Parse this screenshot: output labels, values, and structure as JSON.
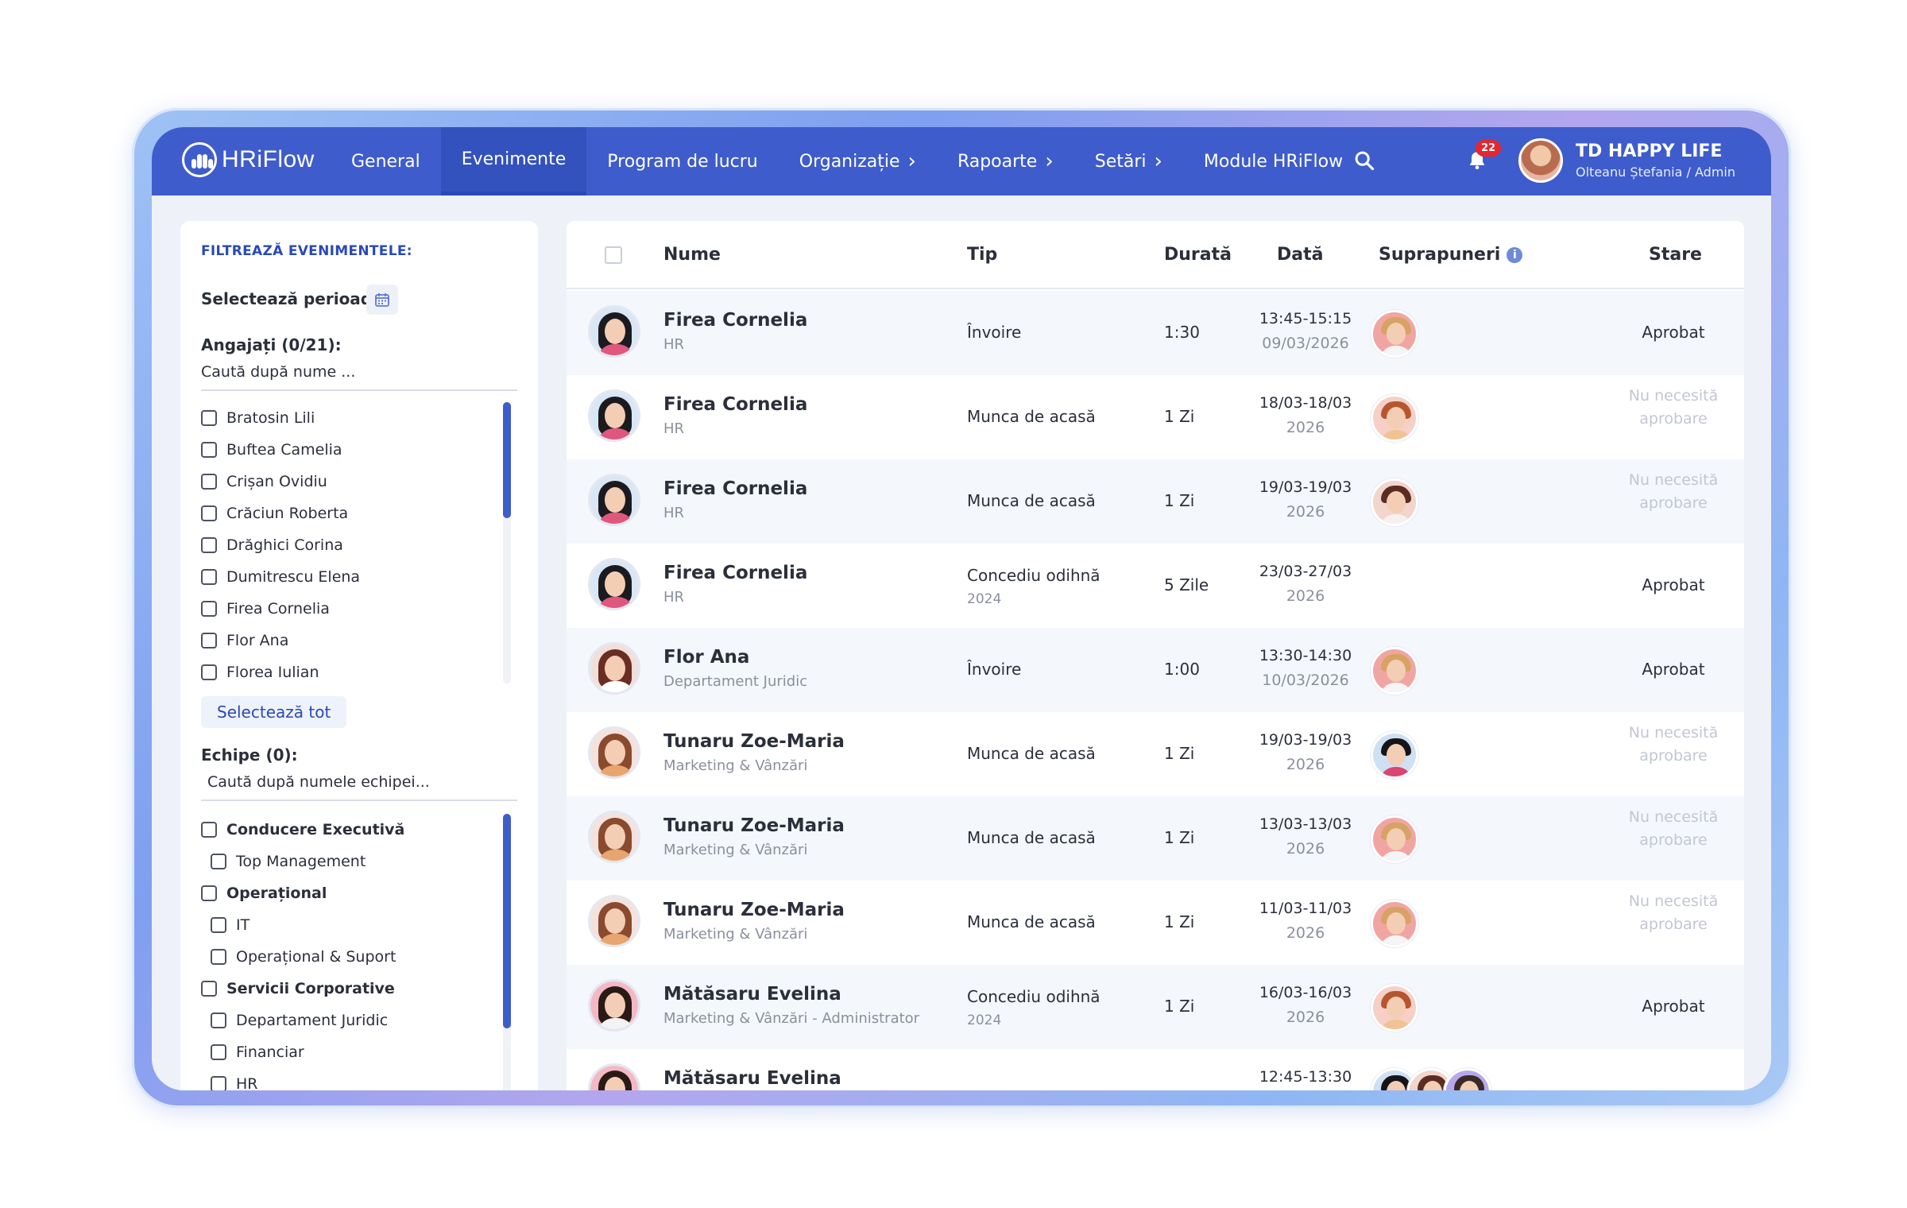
{
  "app": {
    "name": "HRiFlow",
    "company": "TD HAPPY LIFE",
    "user": "Olteanu Ștefania / Admin",
    "notifications": "22"
  },
  "nav": [
    {
      "label": "General",
      "dropdown": false,
      "active": false
    },
    {
      "label": "Evenimente",
      "dropdown": false,
      "active": true
    },
    {
      "label": "Program de lucru",
      "dropdown": false,
      "active": false
    },
    {
      "label": "Organizație",
      "dropdown": true,
      "active": false
    },
    {
      "label": "Rapoarte",
      "dropdown": true,
      "active": false
    },
    {
      "label": "Setări",
      "dropdown": true,
      "active": false
    },
    {
      "label": "Module HRiFlow",
      "dropdown": false,
      "active": false
    }
  ],
  "filter": {
    "title": "FILTREAZĂ EVENIMENTELE:",
    "period_label": "Selectează perioada:",
    "employees_label": "Angajați (0/21):",
    "employees_placeholder": "Caută după nume ...",
    "employees": [
      "Bratosin Lili",
      "Buftea Camelia",
      "Crișan Ovidiu",
      "Crăciun Roberta",
      "Drăghici Corina",
      "Dumitrescu Elena",
      "Firea Cornelia",
      "Flor Ana",
      "Florea Iulian"
    ],
    "select_all": "Selectează tot",
    "teams_label": "Echipe (0):",
    "teams_placeholder": "Caută după numele echipei...",
    "teams": [
      {
        "label": "Conducere Executivă",
        "group": true
      },
      {
        "label": "Top Management",
        "group": false
      },
      {
        "label": "Operațional",
        "group": true
      },
      {
        "label": "IT",
        "group": false
      },
      {
        "label": "Operațional & Suport",
        "group": false
      },
      {
        "label": "Servicii Corporative",
        "group": true
      },
      {
        "label": "Departament Juridic",
        "group": false
      },
      {
        "label": "Financiar",
        "group": false
      },
      {
        "label": "HR",
        "group": false
      }
    ]
  },
  "table": {
    "headers": {
      "name": "Nume",
      "type": "Tip",
      "duration": "Durată",
      "date": "Dată",
      "overlaps": "Suprapuneri",
      "status": "Stare"
    },
    "rows": [
      {
        "name": "Firea Cornelia",
        "dept": "HR",
        "type": "Învoire",
        "type_sub": "",
        "duration": "1:30",
        "date1": "13:45-15:15",
        "date2": "09/03/2026",
        "status": "Aprobat",
        "approved": true,
        "avatar": "cornelia",
        "overlaps": [
          "man-blond"
        ]
      },
      {
        "name": "Firea Cornelia",
        "dept": "HR",
        "type": "Munca de acasă",
        "type_sub": "",
        "duration": "1 Zi",
        "date1": "18/03-18/03",
        "date2": "2026",
        "status": "Nu necesită aprobare",
        "approved": false,
        "avatar": "cornelia",
        "overlaps": [
          "man-ginger"
        ]
      },
      {
        "name": "Firea Cornelia",
        "dept": "HR",
        "type": "Munca de acasă",
        "type_sub": "",
        "duration": "1 Zi",
        "date1": "19/03-19/03",
        "date2": "2026",
        "status": "Nu necesită aprobare",
        "approved": false,
        "avatar": "cornelia",
        "overlaps": [
          "woman-brown"
        ]
      },
      {
        "name": "Firea Cornelia",
        "dept": "HR",
        "type": "Concediu odihnă",
        "type_sub": "2024",
        "duration": "5 Zile",
        "date1": "23/03-27/03",
        "date2": "2026",
        "status": "Aprobat",
        "approved": true,
        "avatar": "cornelia",
        "overlaps": []
      },
      {
        "name": "Flor Ana",
        "dept": "Departament Juridic",
        "type": "Învoire",
        "type_sub": "",
        "duration": "1:00",
        "date1": "13:30-14:30",
        "date2": "10/03/2026",
        "status": "Aprobat",
        "approved": true,
        "avatar": "ana",
        "overlaps": [
          "man-blond"
        ]
      },
      {
        "name": "Tunaru Zoe-Maria",
        "dept": "Marketing & Vânzări",
        "type": "Munca de acasă",
        "type_sub": "",
        "duration": "1 Zi",
        "date1": "19/03-19/03",
        "date2": "2026",
        "status": "Nu necesită aprobare",
        "approved": false,
        "avatar": "zoe",
        "overlaps": [
          "woman-dark"
        ]
      },
      {
        "name": "Tunaru Zoe-Maria",
        "dept": "Marketing & Vânzări",
        "type": "Munca de acasă",
        "type_sub": "",
        "duration": "1 Zi",
        "date1": "13/03-13/03",
        "date2": "2026",
        "status": "Nu necesită aprobare",
        "approved": false,
        "avatar": "zoe",
        "overlaps": [
          "man-blond"
        ]
      },
      {
        "name": "Tunaru Zoe-Maria",
        "dept": "Marketing & Vânzări",
        "type": "Munca de acasă",
        "type_sub": "",
        "duration": "1 Zi",
        "date1": "11/03-11/03",
        "date2": "2026",
        "status": "Nu necesită aprobare",
        "approved": false,
        "avatar": "zoe",
        "overlaps": [
          "man-blond"
        ]
      },
      {
        "name": "Mătăsaru Evelina",
        "dept": "Marketing & Vânzări - Administrator",
        "type": "Concediu odihnă",
        "type_sub": "2024",
        "duration": "1 Zi",
        "date1": "16/03-16/03",
        "date2": "2026",
        "status": "Aprobat",
        "approved": true,
        "avatar": "evelina",
        "overlaps": [
          "man-ginger"
        ]
      },
      {
        "name": "Mătăsaru Evelina",
        "dept": "",
        "type": "",
        "type_sub": "",
        "duration": "",
        "date1": "12:45-13:30",
        "date2": "",
        "status": "",
        "approved": true,
        "avatar": "evelina",
        "overlaps": [
          "woman-dark",
          "woman-brown",
          "woman-purple"
        ]
      }
    ]
  },
  "colors": {
    "navbar": "#3e5ccc",
    "accent": "#2a49b7",
    "badge": "#e6262f",
    "muted_status": "#c2c7d0"
  },
  "icons": {
    "search": "search-icon",
    "bell": "bell-icon",
    "calendar": "calendar-icon",
    "info": "info-icon",
    "chevron": "chevron-right-icon"
  }
}
